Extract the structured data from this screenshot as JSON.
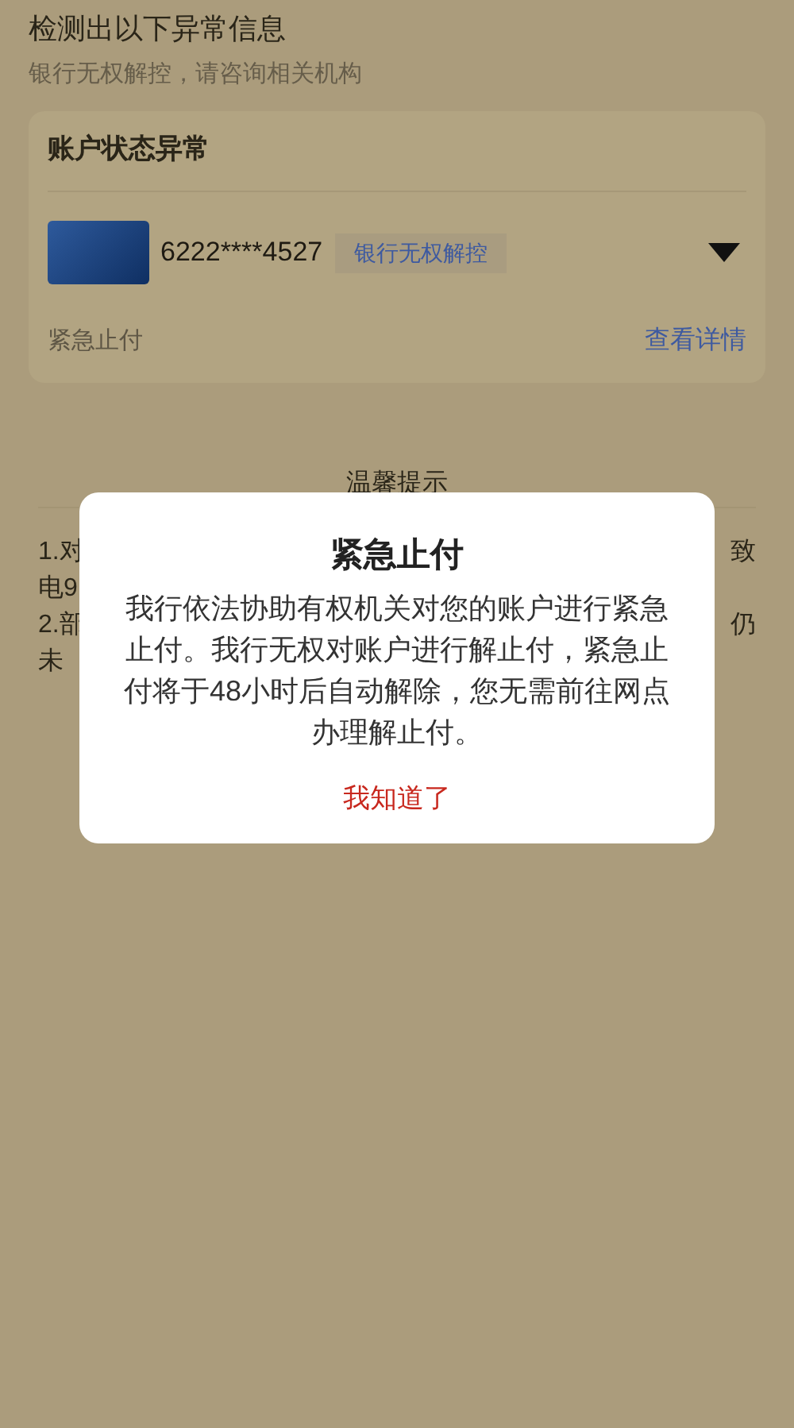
{
  "header": {
    "title": "检测出以下异常信息",
    "subtitle": "银行无权解控，请咨询相关机构"
  },
  "account_card": {
    "title": "账户状态异常",
    "card_number": "6222****4527",
    "badge": "银行无权解控",
    "expanded": false,
    "status": "紧急止付",
    "details_link": "查看详情"
  },
  "tips": {
    "title": "温馨提示",
    "lines": [
      {
        "left": "1.对",
        "right": "致"
      },
      {
        "left": "电9"
      },
      {
        "left": "2.部",
        "right": "仍"
      },
      {
        "left": "未"
      }
    ]
  },
  "dialog": {
    "title": "紧急止付",
    "message": "我行依法协助有权机关对您的账户进行紧急止付。我行无权对账户进行解止付，紧急止付将于48小时后自动解除，您无需前往网点办理解止付。",
    "button": "我知道了"
  }
}
